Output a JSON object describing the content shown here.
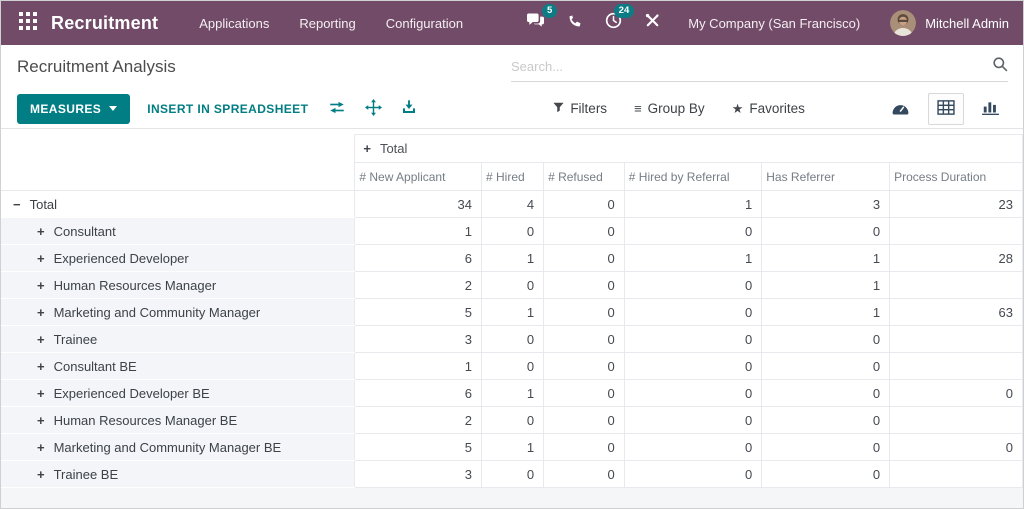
{
  "topbar": {
    "app_name": "Recruitment",
    "menus": [
      "Applications",
      "Reporting",
      "Configuration"
    ],
    "messages_badge": "5",
    "activities_badge": "24",
    "company": "My Company (San Francisco)",
    "user": "Mitchell Admin"
  },
  "page": {
    "title": "Recruitment Analysis"
  },
  "search": {
    "placeholder": "Search..."
  },
  "toolbar": {
    "measures_label": "MEASURES",
    "insert_label": "INSERT IN SPREADSHEET",
    "filters_label": "Filters",
    "groupby_label": "Group By",
    "favorites_label": "Favorites",
    "groupby_glyph": "≡",
    "favorites_glyph": "★"
  },
  "colors": {
    "topbar": "#714B67",
    "accent_teal": "#017e84",
    "badge": "#0c7d84",
    "row_header_bg": "#f4f5f8"
  },
  "pivot": {
    "col_group": {
      "label": "Total",
      "expanded": false
    },
    "measures": [
      "# New Applicant",
      "# Hired",
      "# Refused",
      "# Hired by Referral",
      "Has Referrer",
      "Process Duration"
    ],
    "rows": [
      {
        "label": "Total",
        "level": 0,
        "expanded": true,
        "values": [
          "34",
          "4",
          "0",
          "1",
          "3",
          "23"
        ]
      },
      {
        "label": "Consultant",
        "level": 1,
        "expanded": false,
        "values": [
          "1",
          "0",
          "0",
          "0",
          "0",
          ""
        ]
      },
      {
        "label": "Experienced Developer",
        "level": 1,
        "expanded": false,
        "values": [
          "6",
          "1",
          "0",
          "1",
          "1",
          "28"
        ]
      },
      {
        "label": "Human Resources Manager",
        "level": 1,
        "expanded": false,
        "values": [
          "2",
          "0",
          "0",
          "0",
          "1",
          ""
        ]
      },
      {
        "label": "Marketing and Community Manager",
        "level": 1,
        "expanded": false,
        "values": [
          "5",
          "1",
          "0",
          "0",
          "1",
          "63"
        ]
      },
      {
        "label": "Trainee",
        "level": 1,
        "expanded": false,
        "values": [
          "3",
          "0",
          "0",
          "0",
          "0",
          ""
        ]
      },
      {
        "label": "Consultant BE",
        "level": 1,
        "expanded": false,
        "values": [
          "1",
          "0",
          "0",
          "0",
          "0",
          ""
        ]
      },
      {
        "label": "Experienced Developer BE",
        "level": 1,
        "expanded": false,
        "values": [
          "6",
          "1",
          "0",
          "0",
          "0",
          "0"
        ]
      },
      {
        "label": "Human Resources Manager BE",
        "level": 1,
        "expanded": false,
        "values": [
          "2",
          "0",
          "0",
          "0",
          "0",
          ""
        ]
      },
      {
        "label": "Marketing and Community Manager BE",
        "level": 1,
        "expanded": false,
        "values": [
          "5",
          "1",
          "0",
          "0",
          "0",
          "0"
        ]
      },
      {
        "label": "Trainee BE",
        "level": 1,
        "expanded": false,
        "values": [
          "3",
          "0",
          "0",
          "0",
          "0",
          ""
        ]
      }
    ]
  }
}
